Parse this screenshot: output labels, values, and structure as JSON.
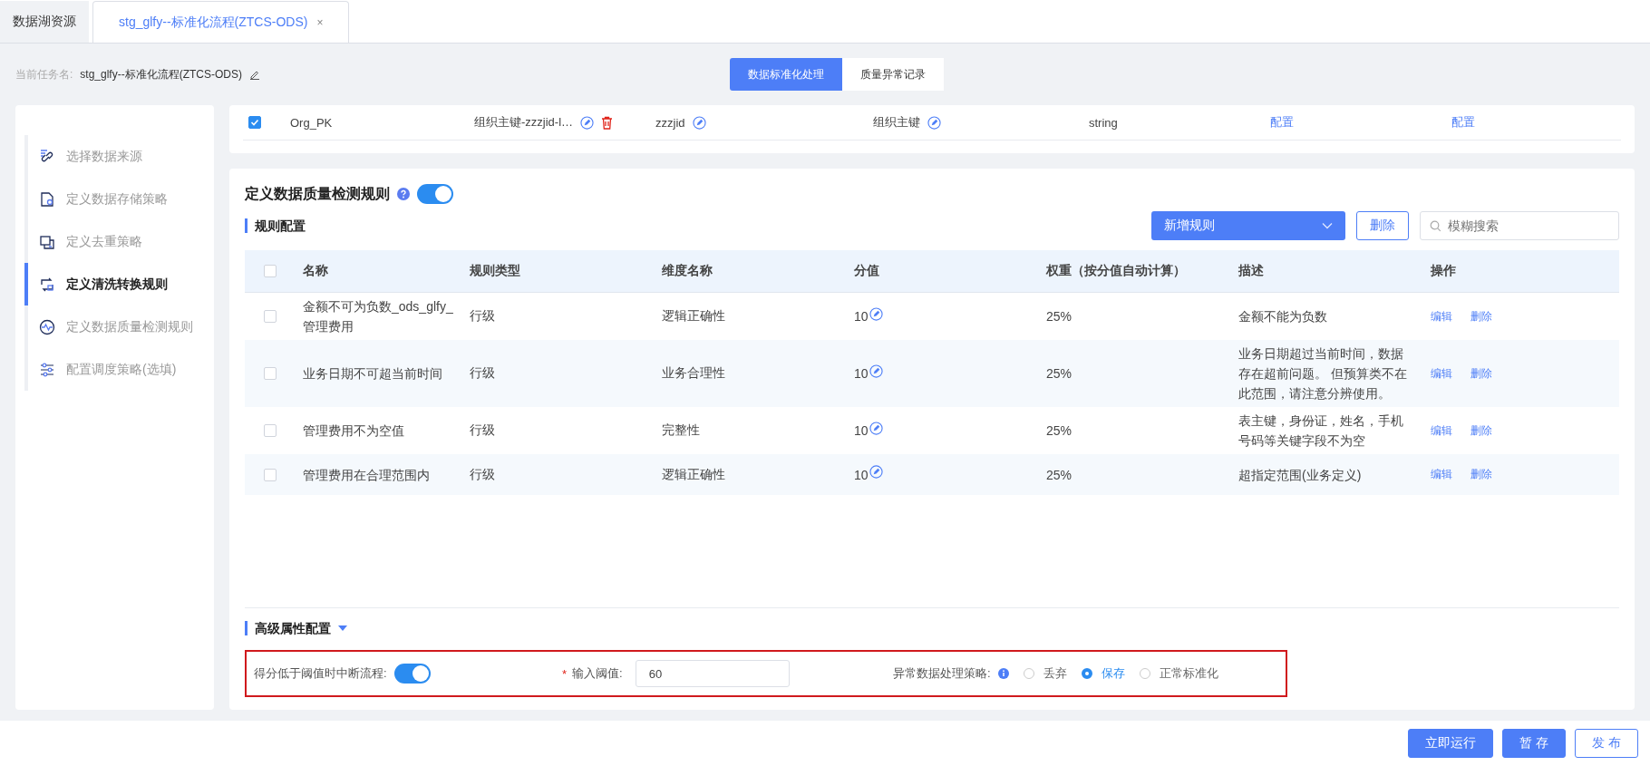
{
  "tabs": [
    {
      "label": "数据湖资源",
      "selected": false
    },
    {
      "label": "stg_glfy--标准化流程(ZTCS-ODS)",
      "selected": true,
      "close": "×"
    }
  ],
  "task": {
    "label": "当前任务名:",
    "name": "stg_glfy--标准化流程(ZTCS-ODS)"
  },
  "view_switch": [
    {
      "label": "数据标准化处理",
      "selected": true
    },
    {
      "label": "质量异常记录",
      "selected": false
    }
  ],
  "steps": [
    {
      "label": "选择数据来源",
      "selected": false
    },
    {
      "label": "定义数据存储策略",
      "selected": false
    },
    {
      "label": "定义去重策略",
      "selected": false
    },
    {
      "label": "定义清洗转换规则",
      "selected": true
    },
    {
      "label": "定义数据质量检测规则",
      "selected": false
    },
    {
      "label": "配置调度策略(选填)",
      "selected": false
    }
  ],
  "field_row": {
    "checked": true,
    "name": "Org_PK",
    "description": "组织主键-zzzjid-l…",
    "column": "zzzjid",
    "label": "组织主键",
    "type": "string",
    "link_1": "配置",
    "link_2": "配置"
  },
  "quality": {
    "title": "定义数据质量检测规则",
    "enabled": true,
    "subtitle": "规则配置",
    "add_button": "新增规则",
    "delete_button": "删除",
    "search_placeholder": "模糊搜索",
    "header_checked": false,
    "columns": [
      "名称",
      "规则类型",
      "维度名称",
      "分值",
      "权重（按分值自动计算）",
      "描述",
      "操作"
    ],
    "rows": [
      {
        "checked": false,
        "name": "金额不可为负数_ods_glfy_管理费用",
        "type": "行级",
        "dimension": "逻辑正确性",
        "score": "10",
        "weight": "25%",
        "description": "金额不能为负数",
        "edit": "编辑",
        "delete": "删除"
      },
      {
        "checked": false,
        "name": "业务日期不可超当前时间",
        "type": "行级",
        "dimension": "业务合理性",
        "score": "10",
        "weight": "25%",
        "description": "业务日期超过当前时间，数据存在超前问题。 但预算类不在此范围，请注意分辨使用。",
        "edit": "编辑",
        "delete": "删除"
      },
      {
        "checked": false,
        "name": "管理费用不为空值",
        "type": "行级",
        "dimension": "完整性",
        "score": "10",
        "weight": "25%",
        "description": "表主键，身份证，姓名，手机号码等关键字段不为空",
        "edit": "编辑",
        "delete": "删除"
      },
      {
        "checked": false,
        "name": "管理费用在合理范围内",
        "type": "行级",
        "dimension": "逻辑正确性",
        "score": "10",
        "weight": "25%",
        "description": "超指定范围(业务定义)",
        "edit": "编辑",
        "delete": "删除"
      }
    ]
  },
  "advanced": {
    "title": "高级属性配置",
    "expanded": true,
    "highlighted": true,
    "interrupt_label": "得分低于阈值时中断流程:",
    "interrupt_on": true,
    "required_mark": "*",
    "threshold_label": "输入阈值:",
    "threshold_value": "60",
    "strategy_label": "异常数据处理策略:",
    "strategy_options": [
      {
        "label": "丢弃",
        "selected": false
      },
      {
        "label": "保存",
        "selected": true
      },
      {
        "label": "正常标准化",
        "selected": false
      }
    ]
  },
  "footer_buttons": [
    {
      "label": "立即运行",
      "kind": "primary"
    },
    {
      "label": "暂 存",
      "kind": "primary"
    },
    {
      "label": "发 布",
      "kind": "outline"
    }
  ]
}
